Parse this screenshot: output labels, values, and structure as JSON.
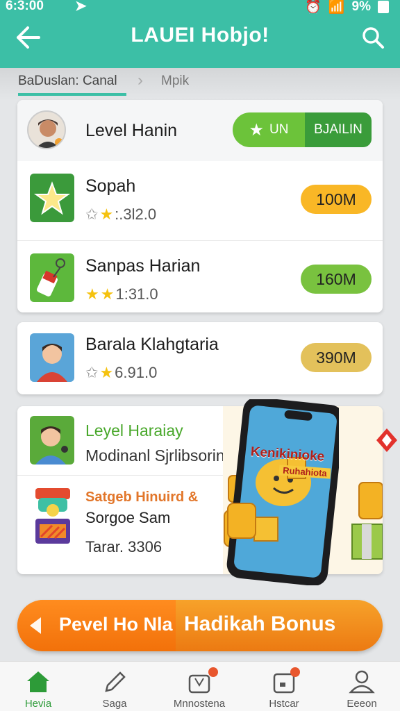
{
  "status": {
    "time": "6:3:00",
    "battery": "9%"
  },
  "header": {
    "title": "LAUEI Hobjo!"
  },
  "breadcrumb": {
    "first": "BaDuslan: Canal",
    "second": "Mpik"
  },
  "card1": {
    "title": "Level Hanin",
    "toggle_left": "UN",
    "toggle_right": "BJAILIN",
    "rows": [
      {
        "name": "Sopah",
        "rating": ":.3l2.0",
        "value": "100M"
      },
      {
        "name": "Sanpas Harian",
        "rating": "1:31.0",
        "value": "160M"
      }
    ]
  },
  "card2": {
    "name": "Barala Klahgtaria",
    "rating": "6.91.0",
    "value": "390M"
  },
  "card3": {
    "name": "Leyel Haraiay",
    "sub": "Modinanl Sjrlibsorin",
    "offer": "Satgeb Hinuird &",
    "offer2": "Sorgoe Sam",
    "offer3": "Tarar. 3306",
    "promo_title": "Kenikinioke",
    "promo_sub": "Ruhahiota"
  },
  "banner": {
    "left": "Pevel Ho Nla",
    "right": "Hadikah Bonus"
  },
  "nav": [
    {
      "label": "Hevia"
    },
    {
      "label": "Saga"
    },
    {
      "label": "Mnnostena"
    },
    {
      "label": "Hstcar"
    },
    {
      "label": "Eeeon"
    }
  ],
  "colors": {
    "header": "#3cbfa6",
    "accent_green": "#6cc33a",
    "orange": "#f28a1c"
  }
}
